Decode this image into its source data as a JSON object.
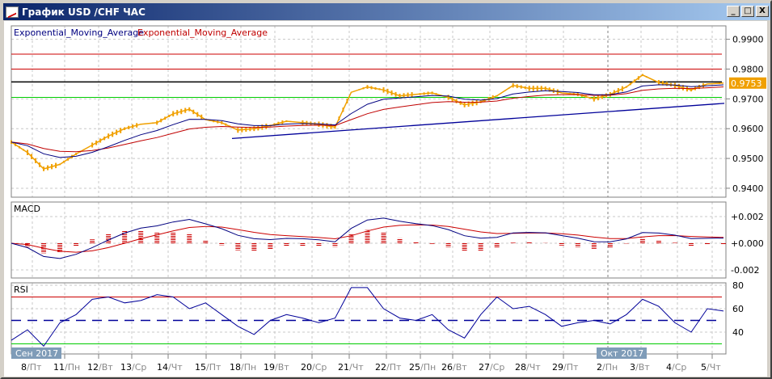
{
  "window": {
    "title": "График USD /CHF  ЧАС",
    "minimize": "_",
    "maximize": "□",
    "close": "X"
  },
  "legend": {
    "ema_fast": "Exponential_Moving_Average",
    "ema_slow": "Exponential_Moving_Average"
  },
  "colors": {
    "price": "#f0a000",
    "ema_fast": "#000080",
    "ema_slow": "#c00000",
    "rsi": "#000099",
    "level_red": "#cc0000",
    "level_green": "#00cc00",
    "trend": "#000099",
    "current_bg": "#f0a000",
    "month_badge": "#7f9cb8"
  },
  "chart_data": [
    {
      "type": "line",
      "title": "USD/CHF H1",
      "price_axis": {
        "ticks": [
          "0.9900",
          "0.9800",
          "0.9700",
          "0.9600",
          "0.9500",
          "0.9400"
        ],
        "range": [
          0.937,
          0.9945
        ]
      },
      "current_price": "0.9753",
      "price": [
        0.9555,
        0.952,
        0.9465,
        0.948,
        0.9515,
        0.9545,
        0.9575,
        0.96,
        0.9615,
        0.962,
        0.965,
        0.9665,
        0.963,
        0.962,
        0.9595,
        0.96,
        0.961,
        0.9625,
        0.962,
        0.9615,
        0.9605,
        0.9722,
        0.974,
        0.973,
        0.971,
        0.9715,
        0.972,
        0.9705,
        0.968,
        0.969,
        0.971,
        0.9745,
        0.9735,
        0.9735,
        0.972,
        0.9715,
        0.97,
        0.9715,
        0.974,
        0.978,
        0.9755,
        0.9745,
        0.973,
        0.975,
        0.9753
      ],
      "levels": [
        {
          "value": 0.985,
          "color": "red"
        },
        {
          "value": 0.98,
          "color": "red"
        },
        {
          "value": 0.9757,
          "color": "black"
        },
        {
          "value": 0.9705,
          "color": "green"
        }
      ],
      "trendline": {
        "from": [
          0.9567,
          "18/Пн"
        ],
        "to": [
          0.9685,
          "5/Чт"
        ]
      },
      "ema_alpha": {
        "fast": 0.35,
        "slow": 0.18
      }
    },
    {
      "type": "line",
      "title": "MACD",
      "axis": {
        "ticks": [
          "+0.002",
          "+0.000",
          "-0.002"
        ],
        "range": [
          -0.0026,
          0.0026
        ]
      }
    },
    {
      "type": "line",
      "title": "RSI",
      "axis": {
        "ticks": [
          "80",
          "60",
          "40"
        ],
        "range": [
          25,
          82
        ]
      },
      "levels": [
        70,
        50,
        30
      ],
      "values": [
        33,
        42,
        28,
        48,
        55,
        68,
        70,
        65,
        67,
        72,
        70,
        60,
        65,
        55,
        45,
        38,
        50,
        55,
        52,
        48,
        52,
        78,
        78,
        60,
        52,
        50,
        55,
        42,
        35,
        55,
        70,
        60,
        62,
        55,
        45,
        48,
        50,
        47,
        55,
        68,
        62,
        48,
        40,
        60,
        58
      ]
    }
  ],
  "time_axis": {
    "months": [
      "Сен 2017",
      "Окт 2017"
    ],
    "labels": [
      [
        "8",
        "Пт"
      ],
      [
        "11",
        "Пн"
      ],
      [
        "12",
        "Вт"
      ],
      [
        "13",
        "Ср"
      ],
      [
        "14",
        "Чт"
      ],
      [
        "15",
        "Пт"
      ],
      [
        "18",
        "Пн"
      ],
      [
        "19",
        "Вт"
      ],
      [
        "20",
        "Ср"
      ],
      [
        "21",
        "Чт"
      ],
      [
        "22",
        "Пт"
      ],
      [
        "25",
        "Пн"
      ],
      [
        "26",
        "Вт"
      ],
      [
        "27",
        "Ср"
      ],
      [
        "28",
        "Чт"
      ],
      [
        "29",
        "Пт"
      ],
      [
        "2",
        "Пн"
      ],
      [
        "3",
        "Вт"
      ],
      [
        "4",
        "Ср"
      ],
      [
        "5",
        "Чт"
      ]
    ]
  }
}
